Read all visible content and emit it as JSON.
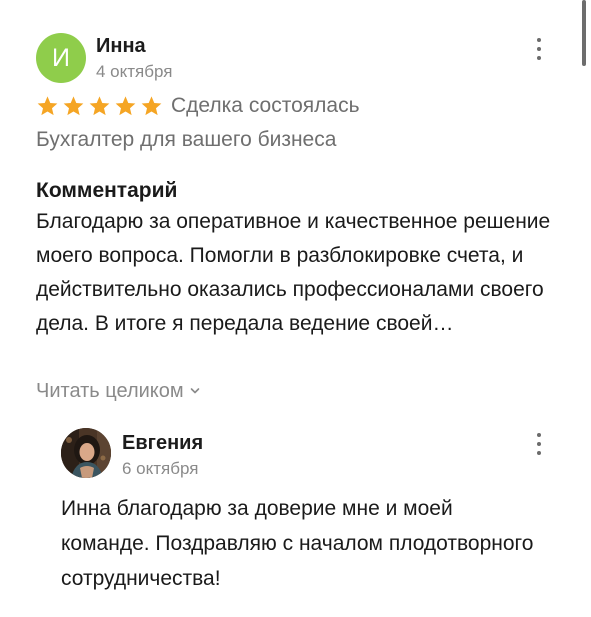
{
  "review": {
    "author": {
      "initial": "И",
      "name": "Инна",
      "avatar_color": "#8fcd4b"
    },
    "date": "4 октября",
    "rating": 5,
    "rating_max": 5,
    "star_color": "#f5a524",
    "deal_status": "Сделка состоялась",
    "service": "Бухгалтер для вашего бизнеса",
    "comment_label": "Комментарий",
    "comment_text": "Благодарю за оперативное и качественное решение моего вопроса. Помогли в разблокировке счета, и действительно оказались профессионалами своего дела. В итоге я передала ведение своей…",
    "read_more_label": "Читать целиком",
    "more_icon": "kebab-menu-icon"
  },
  "reply": {
    "author": {
      "name": "Евгения",
      "avatar": "user-photo-avatar"
    },
    "date": "6 октября",
    "text": "Инна благодарю за доверие мне и моей команде. Поздравляю с началом плодотворного сотрудничества!",
    "more_icon": "kebab-menu-icon"
  }
}
